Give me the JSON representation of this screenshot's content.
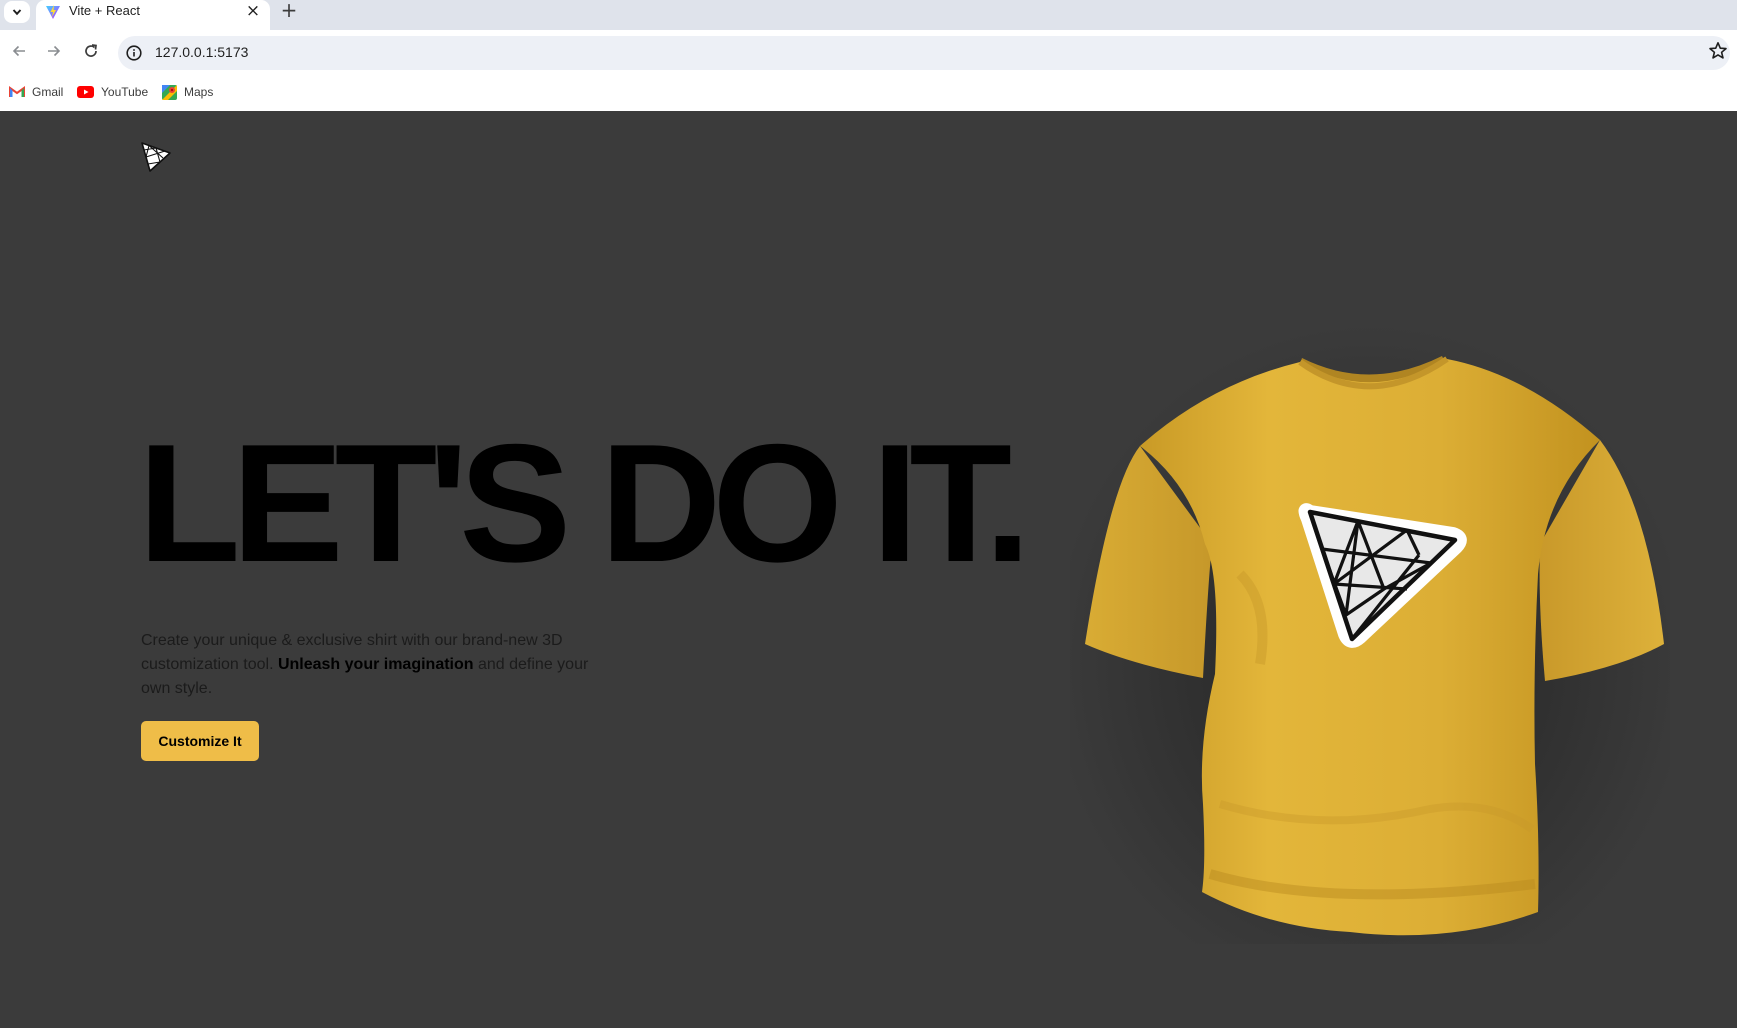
{
  "browser": {
    "tab": {
      "title": "Vite + React",
      "close_glyph": "×"
    },
    "new_tab_glyph": "+",
    "address": {
      "url": "127.0.0.1:5173"
    },
    "bookmarks": [
      {
        "label": "Gmail",
        "icon": "gmail-icon"
      },
      {
        "label": "YouTube",
        "icon": "youtube-icon"
      },
      {
        "label": "Maps",
        "icon": "maps-icon"
      }
    ]
  },
  "page": {
    "headline": "LET'S DO IT.",
    "intro": {
      "before": "Create your unique & exclusive shirt with our brand-new 3D customization tool. ",
      "emphasis": "Unleash your imagination",
      "after": " and define your own style."
    },
    "cta_label": "Customize It",
    "colors": {
      "background": "#3b3b3b",
      "shirt": "#e0b437",
      "button": "#efbd48",
      "headline": "#000000"
    },
    "icons": {
      "logo": "threejs-logo-icon",
      "shirt_decal": "threejs-logo-icon"
    }
  }
}
